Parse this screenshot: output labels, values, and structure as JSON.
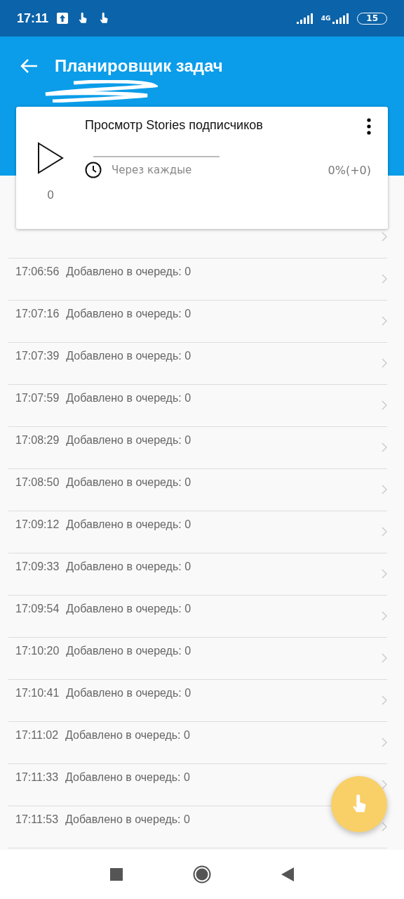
{
  "status_bar": {
    "time": "17:11",
    "network": "4G",
    "battery": "15"
  },
  "app_bar": {
    "title": "Планировщик задач"
  },
  "task": {
    "title": "Просмотр Stories подписчиков",
    "schedule": "Через каждые",
    "count": "0",
    "progress": "0%(+0)"
  },
  "log": [
    {
      "time": "17:06:56",
      "text": "Добавлено в очередь: 0"
    },
    {
      "time": "17:07:16",
      "text": "Добавлено в очередь: 0"
    },
    {
      "time": "17:07:39",
      "text": "Добавлено в очередь: 0"
    },
    {
      "time": "17:07:59",
      "text": "Добавлено в очередь: 0"
    },
    {
      "time": "17:08:29",
      "text": "Добавлено в очередь: 0"
    },
    {
      "time": "17:08:50",
      "text": "Добавлено в очередь: 0"
    },
    {
      "time": "17:09:12",
      "text": "Добавлено в очередь: 0"
    },
    {
      "time": "17:09:33",
      "text": "Добавлено в очередь: 0"
    },
    {
      "time": "17:09:54",
      "text": "Добавлено в очередь: 0"
    },
    {
      "time": "17:10:20",
      "text": "Добавлено в очередь: 0"
    },
    {
      "time": "17:10:41",
      "text": "Добавлено в очередь: 0"
    },
    {
      "time": "17:11:02",
      "text": "Добавлено в очередь: 0"
    },
    {
      "time": "17:11:33",
      "text": "Добавлено в очередь: 0"
    },
    {
      "time": "17:11:53",
      "text": "Добавлено в очередь: 0"
    }
  ]
}
